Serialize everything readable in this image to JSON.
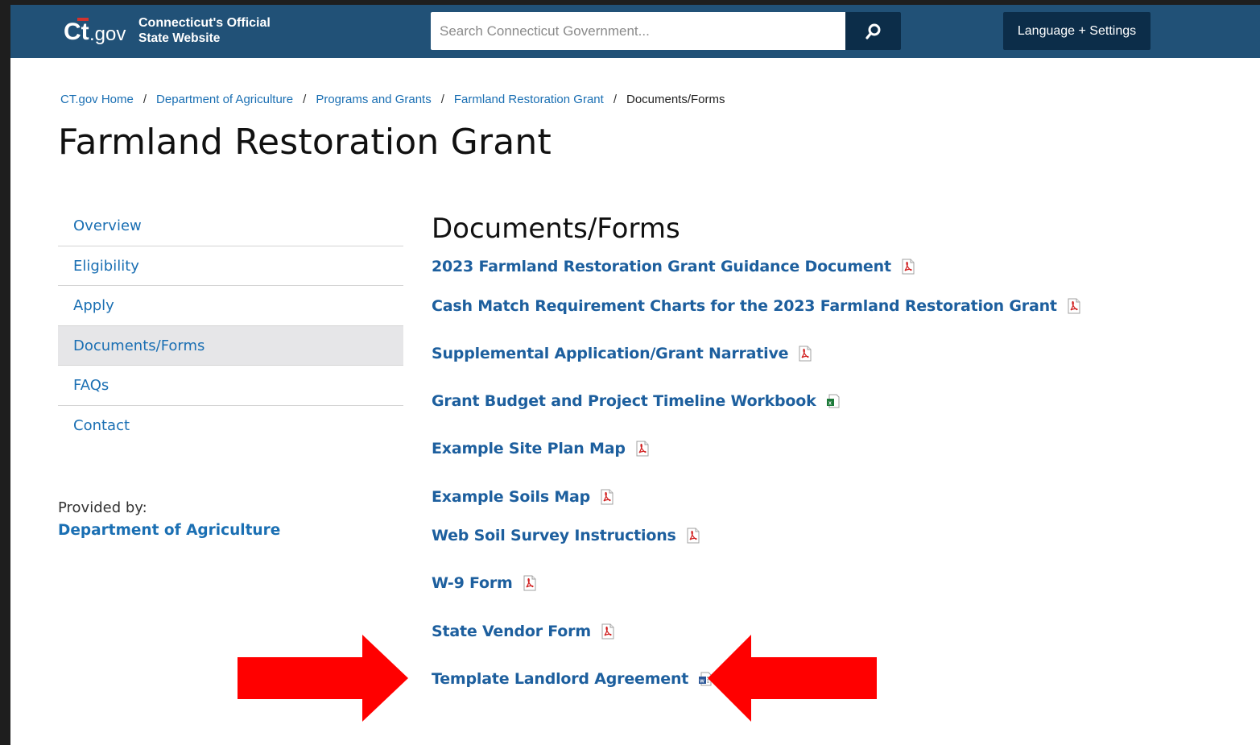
{
  "header": {
    "logo_text": "Ct.gov",
    "tagline_line1": "Connecticut's Official",
    "tagline_line2": "State Website",
    "search_placeholder": "Search Connecticut Government...",
    "language_button": "Language + Settings"
  },
  "breadcrumb": [
    "CT.gov Home",
    "Department of Agriculture",
    "Programs and Grants",
    "Farmland Restoration Grant",
    "Documents/Forms"
  ],
  "page_title": "Farmland Restoration Grant",
  "sidebar": {
    "items": [
      {
        "label": "Overview",
        "active": false
      },
      {
        "label": "Eligibility",
        "active": false
      },
      {
        "label": "Apply",
        "active": false
      },
      {
        "label": "Documents/Forms",
        "active": true
      },
      {
        "label": "FAQs",
        "active": false
      },
      {
        "label": "Contact",
        "active": false
      }
    ],
    "provided_by_label": "Provided by:",
    "provided_by_dept": "Department of Agriculture"
  },
  "main": {
    "section_title": "Documents/Forms",
    "documents": [
      {
        "label": "2023 Farmland Restoration Grant Guidance Document",
        "icon": "pdf-icon"
      },
      {
        "label": "Cash Match Requirement Charts for the 2023 Farmland Restoration Grant",
        "icon": "pdf-icon"
      },
      {
        "label": "Supplemental Application/Grant Narrative",
        "icon": "pdf-icon"
      },
      {
        "label": "Grant Budget and Project Timeline Workbook",
        "icon": "excel-icon"
      },
      {
        "label": "Example Site Plan Map",
        "icon": "pdf-icon"
      },
      {
        "label": "Example Soils Map",
        "icon": "pdf-icon"
      },
      {
        "label": "Web Soil Survey Instructions",
        "icon": "pdf-icon"
      },
      {
        "label": "W-9 Form",
        "icon": "pdf-icon"
      },
      {
        "label": "State Vendor Form",
        "icon": "pdf-icon"
      },
      {
        "label": "Template Landlord Agreement",
        "icon": "word-icon"
      }
    ]
  },
  "colors": {
    "header_bg": "#215177",
    "header_button_bg": "#0c2d49",
    "link": "#1a6fb3",
    "annotation_arrow": "#ff0000"
  }
}
